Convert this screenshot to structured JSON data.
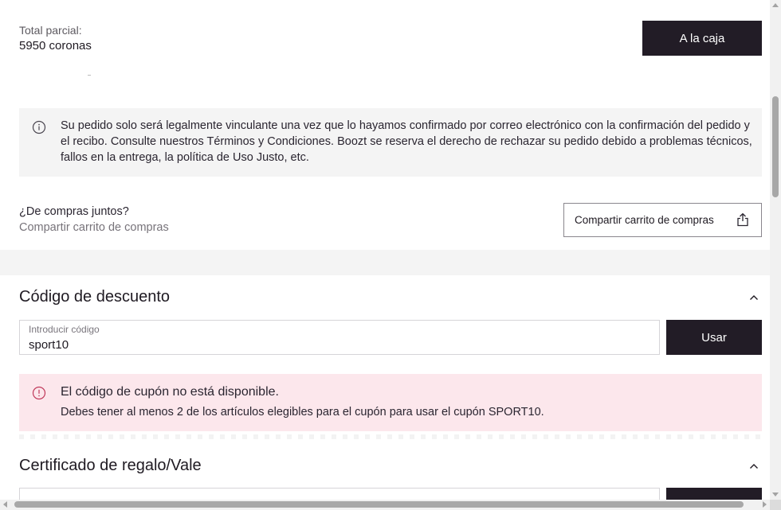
{
  "summary": {
    "subtotal_label": "Total parcial:",
    "subtotal_value": "5950 coronas",
    "checkout_label": "A la caja"
  },
  "info_notice": {
    "icon": "info-icon",
    "text": "Su pedido solo será legalmente vinculante una vez que lo hayamos confirmado por correo electrónico con la confirmación del pedido y el recibo. Consulte nuestros Términos y Condiciones. Boozt se reserva el derecho de rechazar su pedido debido a problemas técnicos, fallos en la entrega, la política de Uso Justo, etc."
  },
  "share": {
    "question": "¿De compras juntos?",
    "subtitle": "Compartir carrito de compras",
    "button_label": "Compartir carrito de compras",
    "button_icon": "share-icon"
  },
  "discount": {
    "title": "Código de descuento",
    "input_label": "Introducir código",
    "input_value": "sport10",
    "apply_label": "Usar",
    "error": {
      "icon": "alert-circle-icon",
      "title": "El código de cupón no está disponible.",
      "message": "Debes tener al menos 2 de los artículos elegibles para el cupón para usar el cupón SPORT10."
    }
  },
  "gift": {
    "title": "Certificado de regalo/Vale"
  },
  "colors": {
    "primary_button": "#221c26",
    "info_bg": "#f4f4f4",
    "error_bg": "#fce7ec",
    "error_icon": "#c0395a"
  }
}
